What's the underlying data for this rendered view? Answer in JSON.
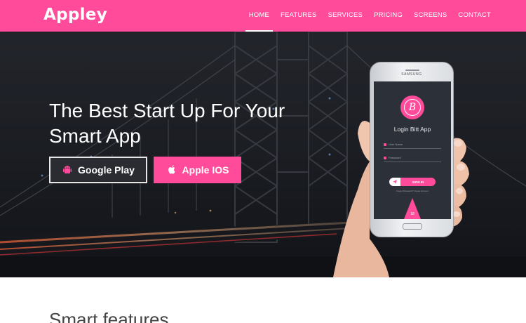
{
  "brand": "Appley",
  "nav": {
    "items": [
      "HOME",
      "FEATURES",
      "SERVICES",
      "PRICING",
      "SCREENS",
      "CONTACT"
    ],
    "active": "HOME"
  },
  "hero": {
    "headline_line1": "The Best Start Up For Your",
    "headline_line2": "Smart App",
    "buttons": {
      "google": {
        "label": "Google Play",
        "icon": "android-icon"
      },
      "apple": {
        "label": "Apple IOS",
        "icon": "apple-icon"
      }
    }
  },
  "phone": {
    "brand_text": "SAMSUNG",
    "app_title": "Login Bitt App",
    "logo_letter": "B",
    "username_label": "User Name",
    "password_label": "Password",
    "signin_label": "SIGN IN",
    "footer_text": "Forgot Password? Create Account",
    "badge_text": "18"
  },
  "section": {
    "title": "Smart features"
  },
  "colors": {
    "accent": "#ff4b9a",
    "dark": "#2a2c31",
    "hero_bg": "#1d1f25"
  }
}
